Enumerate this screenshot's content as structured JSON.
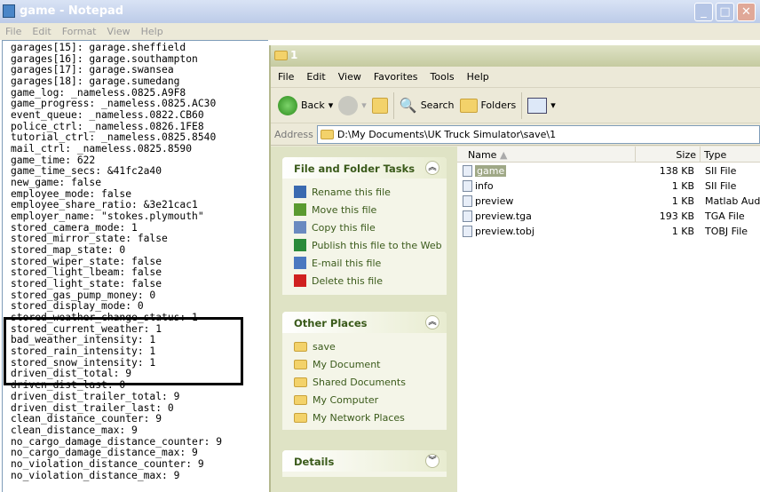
{
  "notepad": {
    "title": "game - Notepad",
    "menu": [
      "File",
      "Edit",
      "Format",
      "View",
      "Help"
    ],
    "lines": [
      "garages[15]: garage.sheffield",
      "garages[16]: garage.southampton",
      "garages[17]: garage.swansea",
      "garages[18]: garage.sumedang",
      "game_log: _nameless.0825.A9F8",
      "game_progress: _nameless.0825.AC30",
      "event_queue: _nameless.0822.CB60",
      "police_ctrl: _nameless.0826.1FE8",
      "tutorial_ctrl: _nameless.0825.8540",
      "mail_ctrl: _nameless.0825.8590",
      "game_time: 622",
      "game_time_secs: &41fc2a40",
      "new_game: false",
      "employee_mode: false",
      "employee_share_ratio: &3e21cac1",
      "employer_name: \"stokes.plymouth\"",
      "stored_camera_mode: 1",
      "stored_mirror_state: false",
      "stored_map_state: 0",
      "stored_wiper_state: false",
      "stored_light_lbeam: false",
      "stored_light_state: false",
      "stored_gas_pump_money: 0",
      "stored_display_mode: 0",
      "stored_weather_change_status: 1",
      "stored_current_weather: 1",
      "bad_weather_intensity: 1",
      "stored_rain_intensity: 1",
      "stored_snow_intensity: 1",
      "driven_dist_total: 9",
      "driven_dist_last: 0",
      "driven_dist_trailer_total: 9",
      "driven_dist_trailer_last: 0",
      "clean_distance_counter: 9",
      "clean_distance_max: 9",
      "no_cargo_damage_distance_counter: 9",
      "no_cargo_damage_distance_max: 9",
      "no_violation_distance_counter: 9",
      "no_violation_distance_max: 9"
    ]
  },
  "explorer": {
    "title": "1",
    "menu": [
      "File",
      "Edit",
      "View",
      "Favorites",
      "Tools",
      "Help"
    ],
    "toolbar": {
      "back": "Back",
      "search": "Search",
      "folders": "Folders"
    },
    "address_label": "Address",
    "address": "D:\\My Documents\\UK Truck Simulator\\save\\1",
    "tasks": {
      "title": "File and Folder Tasks",
      "items": [
        "Rename this file",
        "Move this file",
        "Copy this file",
        "Publish this file to the Web",
        "E-mail this file",
        "Delete this file"
      ]
    },
    "places": {
      "title": "Other Places",
      "items": [
        "save",
        "My Document",
        "Shared Documents",
        "My Computer",
        "My Network Places"
      ]
    },
    "details": {
      "title": "Details"
    },
    "columns": {
      "name": "Name",
      "size": "Size",
      "type": "Type"
    },
    "files": [
      {
        "name": "game",
        "size": "138 KB",
        "type": "SII File"
      },
      {
        "name": "info",
        "size": "1 KB",
        "type": "SII File"
      },
      {
        "name": "preview",
        "size": "1 KB",
        "type": "Matlab Audio"
      },
      {
        "name": "preview.tga",
        "size": "193 KB",
        "type": "TGA File"
      },
      {
        "name": "preview.tobj",
        "size": "1 KB",
        "type": "TOBJ File"
      }
    ]
  }
}
